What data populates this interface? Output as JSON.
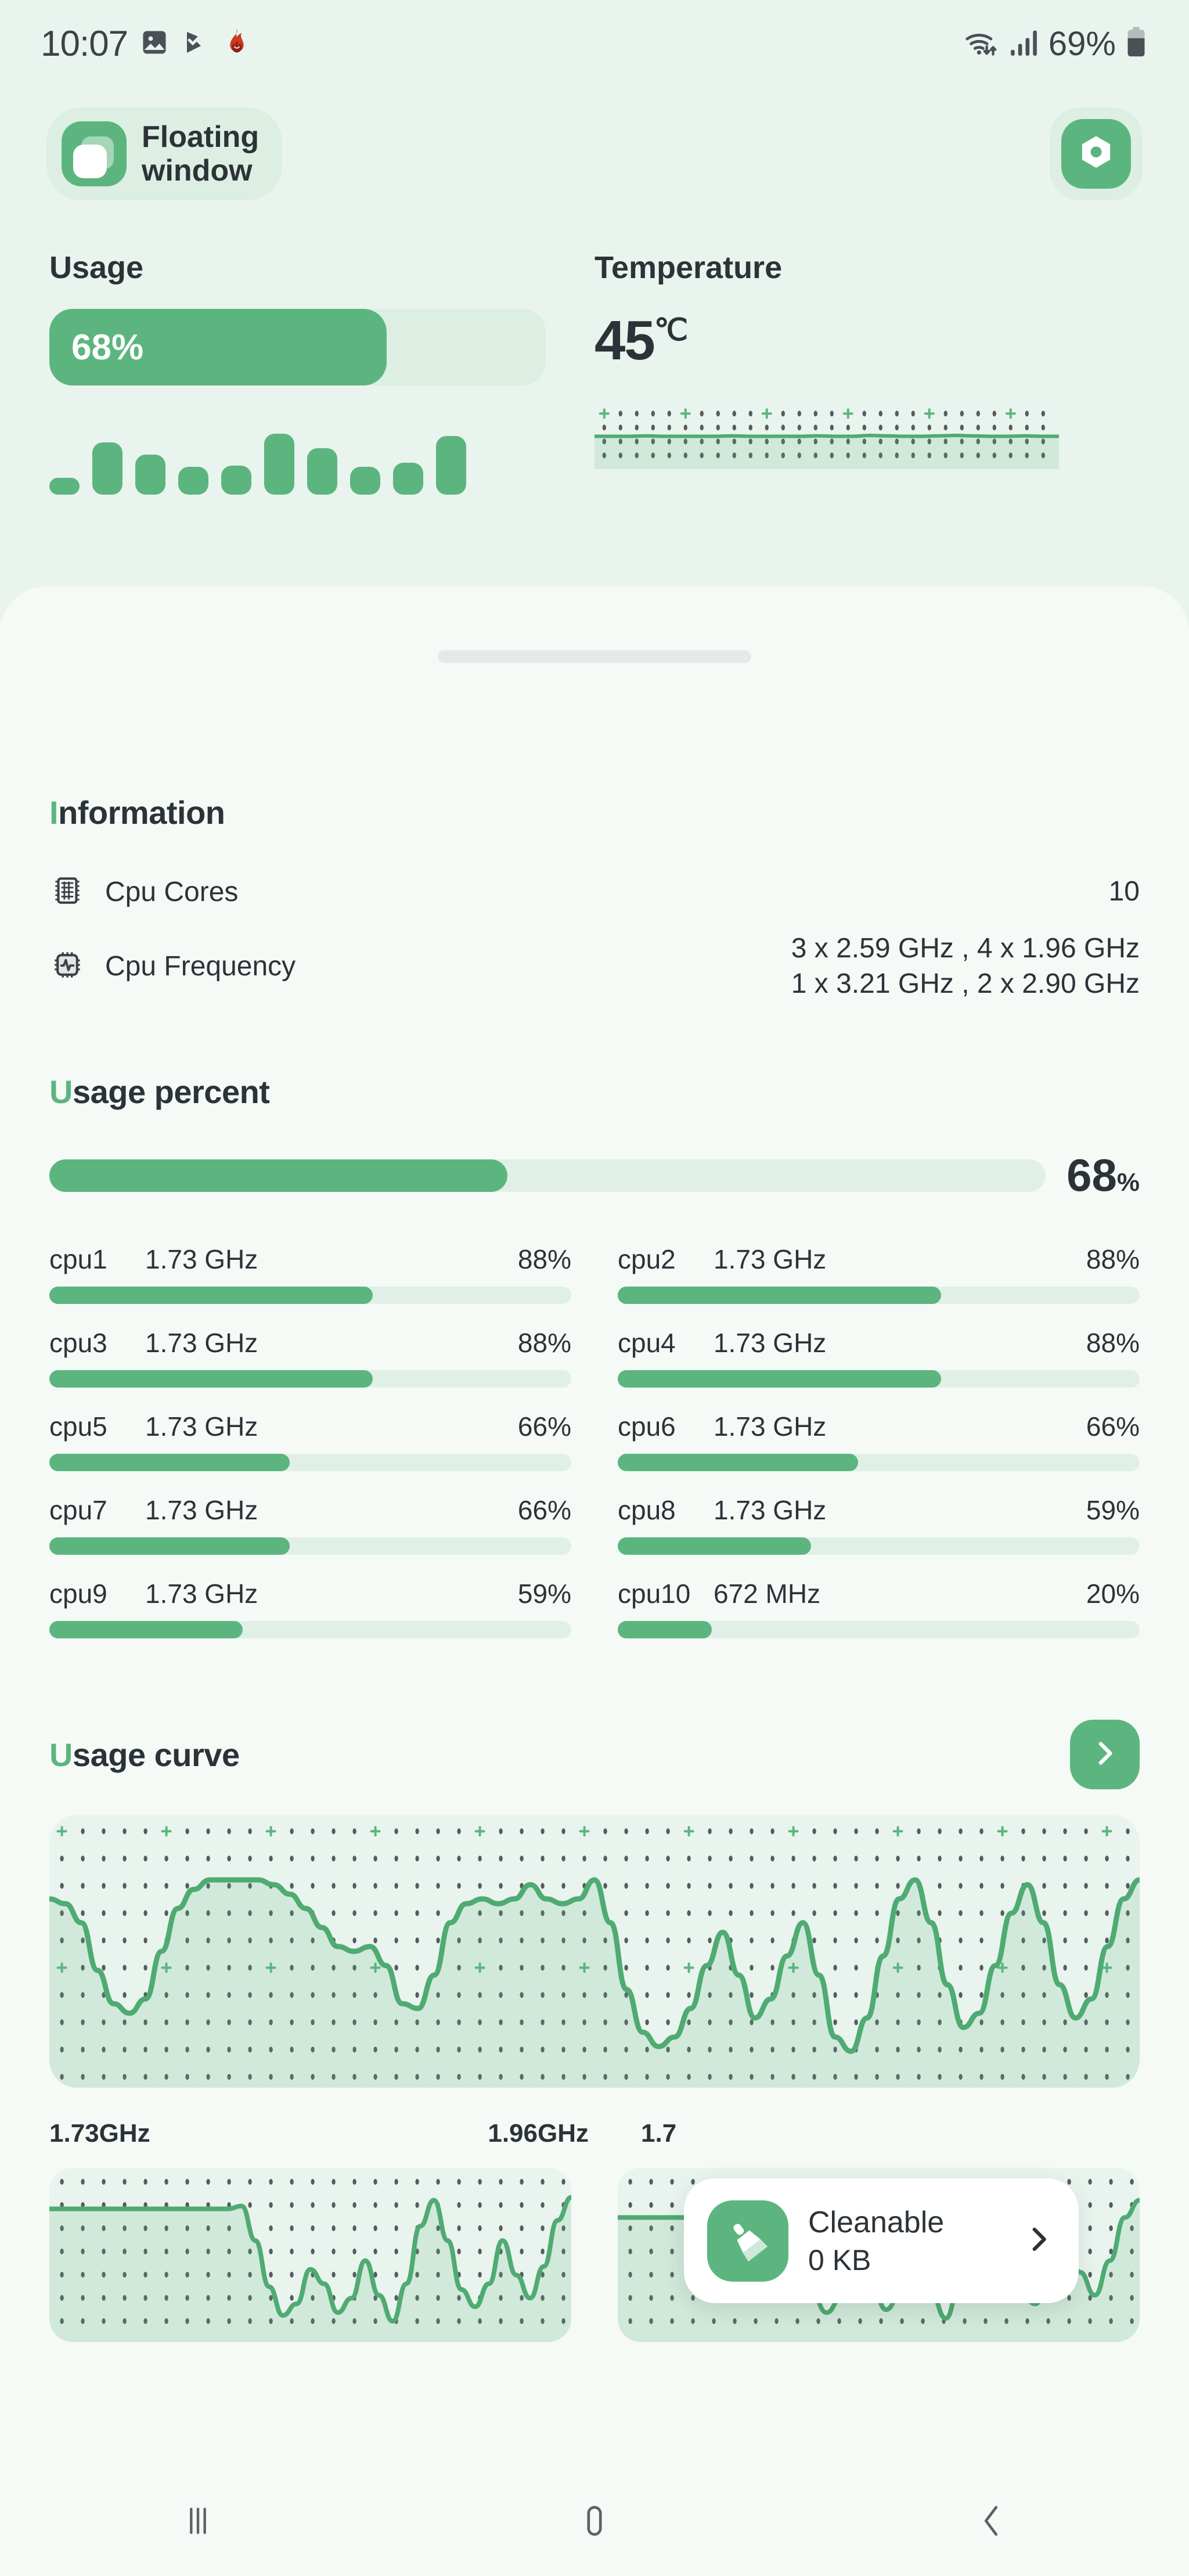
{
  "statusbar": {
    "time": "10:07",
    "battery_percent": "69%",
    "icons": [
      "image-icon",
      "checkmark-flag-icon",
      "flame-icon",
      "wifi-icon",
      "signal-icon",
      "battery-icon"
    ]
  },
  "header": {
    "floating_window_line1": "Floating",
    "floating_window_line2": "window",
    "settings_icon": "hexagon-settings-icon"
  },
  "top_cards": {
    "usage": {
      "title": "Usage",
      "value": "68%",
      "percent": 68,
      "minibars": [
        28,
        86,
        66,
        46,
        48,
        100,
        76,
        46,
        52,
        96
      ]
    },
    "temperature": {
      "title": "Temperature",
      "value": "45",
      "unit": "℃"
    }
  },
  "information": {
    "title": "Information",
    "rows": [
      {
        "icon": "cpu-chip-icon",
        "label": "Cpu Cores",
        "value": "10"
      },
      {
        "icon": "cpu-activity-icon",
        "label": "Cpu Frequency",
        "value": "3 x 2.59 GHz , 4 x 1.96 GHz\n1 x 3.21 GHz , 2 x 2.90 GHz"
      }
    ]
  },
  "usage_percent": {
    "title": "Usage percent",
    "total_value": "68",
    "total_unit": "%",
    "total_percent": 46,
    "cores": [
      {
        "name": "cpu1",
        "freq": "1.73 GHz",
        "pct_label": "88%",
        "pct": 62
      },
      {
        "name": "cpu2",
        "freq": "1.73 GHz",
        "pct_label": "88%",
        "pct": 62
      },
      {
        "name": "cpu3",
        "freq": "1.73 GHz",
        "pct_label": "88%",
        "pct": 62
      },
      {
        "name": "cpu4",
        "freq": "1.73 GHz",
        "pct_label": "88%",
        "pct": 62
      },
      {
        "name": "cpu5",
        "freq": "1.73 GHz",
        "pct_label": "66%",
        "pct": 46
      },
      {
        "name": "cpu6",
        "freq": "1.73 GHz",
        "pct_label": "66%",
        "pct": 46
      },
      {
        "name": "cpu7",
        "freq": "1.73 GHz",
        "pct_label": "66%",
        "pct": 46
      },
      {
        "name": "cpu8",
        "freq": "1.73 GHz",
        "pct_label": "59%",
        "pct": 37
      },
      {
        "name": "cpu9",
        "freq": "1.73 GHz",
        "pct_label": "59%",
        "pct": 37
      },
      {
        "name": "cpu10",
        "freq": "672 MHz",
        "pct_label": "20%",
        "pct": 18
      }
    ]
  },
  "usage_curve": {
    "title": "Usage curve",
    "next_icon": "chevron-right-icon",
    "mini_labels": [
      "1.73GHz",
      "1.96GHz",
      "1.7",
      ""
    ]
  },
  "cleanable": {
    "icon": "broom-icon",
    "title": "Cleanable",
    "size": "0 KB",
    "chevron": "chevron-right-icon"
  },
  "navbar": {
    "recents": "recents-icon",
    "home": "home-icon",
    "back": "back-icon"
  },
  "colors": {
    "accent": "#5cb57f",
    "bg": "#eaf4ee",
    "sheet": "#f5faf7",
    "track": "#e1f0e7",
    "text": "#2c3338"
  },
  "chart_data": [
    {
      "type": "line",
      "title": "Usage curve",
      "name": "usage-curve-main",
      "ylim": [
        0,
        100
      ],
      "xlabel": "",
      "ylabel": "",
      "grid": true,
      "values": [
        72,
        70,
        62,
        42,
        28,
        24,
        30,
        50,
        68,
        76,
        80,
        80,
        80,
        80,
        78,
        74,
        68,
        60,
        52,
        50,
        52,
        44,
        28,
        26,
        40,
        62,
        70,
        72,
        70,
        72,
        78,
        72,
        70,
        72,
        80,
        62,
        34,
        16,
        10,
        14,
        26,
        44,
        58,
        40,
        22,
        30,
        48,
        62,
        40,
        14,
        8,
        22,
        48,
        72,
        80,
        62,
        36,
        18,
        24,
        44,
        66,
        78,
        62,
        36,
        22,
        30,
        52,
        72,
        80
      ]
    },
    {
      "type": "line",
      "name": "usage-curve-mini-left",
      "ylim": [
        0,
        100
      ],
      "grid": true,
      "values": [
        82,
        82,
        82,
        82,
        82,
        82,
        82,
        82,
        82,
        82,
        82,
        82,
        82,
        82,
        84,
        60,
        28,
        8,
        16,
        40,
        30,
        10,
        20,
        46,
        22,
        4,
        30,
        70,
        88,
        60,
        26,
        14,
        30,
        60,
        36,
        20,
        42,
        74,
        90
      ]
    },
    {
      "type": "line",
      "name": "usage-curve-mini-right",
      "ylim": [
        0,
        100
      ],
      "grid": true,
      "values": [
        76,
        76,
        76,
        76,
        76,
        76,
        76,
        76,
        76,
        76,
        76,
        78,
        56,
        24,
        10,
        20,
        44,
        30,
        12,
        24,
        48,
        24,
        6,
        32,
        72,
        86,
        58,
        24,
        16,
        34,
        62,
        38,
        22,
        46,
        76,
        88
      ]
    },
    {
      "type": "line",
      "name": "temperature-mini",
      "ylim": [
        0,
        100
      ],
      "grid": true,
      "values": [
        52,
        52,
        52,
        53,
        52,
        52,
        52,
        52,
        53,
        52,
        52,
        52,
        52,
        53,
        52,
        52,
        54,
        53,
        52,
        52,
        53,
        54,
        53,
        52,
        52,
        53,
        52,
        52
      ]
    }
  ]
}
